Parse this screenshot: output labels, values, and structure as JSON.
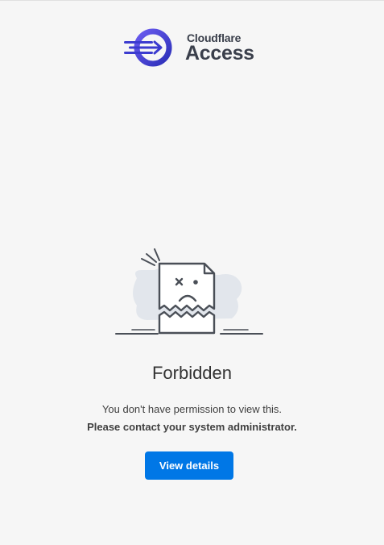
{
  "brand": {
    "line1": "Cloudflare",
    "line2": "Access",
    "icon": "cloudflare-access-logo-icon",
    "accent_color": "#4f46e5"
  },
  "error": {
    "illustration_icon": "broken-document-sad-face-icon",
    "title": "Forbidden",
    "message": "You don't have permission to view this.",
    "message_strong": "Please contact your system administrator."
  },
  "actions": {
    "view_details_label": "View details",
    "button_color": "#0077e6"
  }
}
